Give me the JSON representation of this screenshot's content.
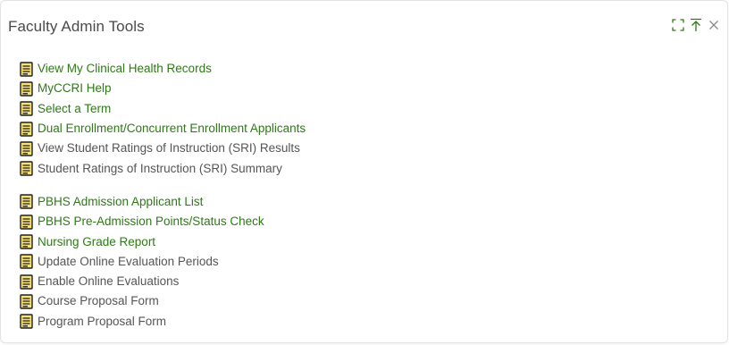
{
  "portlet": {
    "title": "Faculty Admin Tools",
    "controls": [
      {
        "name": "maximize-icon"
      },
      {
        "name": "move-to-top-icon"
      },
      {
        "name": "close-icon"
      }
    ]
  },
  "colors": {
    "link_green": "#2d7a16",
    "text_gray": "#555555",
    "icon_fill": "#f7e27a",
    "icon_stroke": "#1e1e1e"
  },
  "groups": [
    {
      "items": [
        {
          "label": "View My Clinical Health Records",
          "style": "green"
        },
        {
          "label": "MyCCRI Help",
          "style": "green"
        },
        {
          "label": "Select a Term",
          "style": "green"
        },
        {
          "label": "Dual Enrollment/Concurrent Enrollment Applicants",
          "style": "green"
        },
        {
          "label": "View Student Ratings of Instruction (SRI) Results",
          "style": "gray"
        },
        {
          "label": "Student Ratings of Instruction (SRI) Summary",
          "style": "gray"
        }
      ]
    },
    {
      "items": [
        {
          "label": "PBHS Admission Applicant List",
          "style": "green"
        },
        {
          "label": "PBHS Pre-Admission Points/Status Check",
          "style": "green"
        },
        {
          "label": "Nursing Grade Report",
          "style": "green"
        },
        {
          "label": "Update Online Evaluation Periods",
          "style": "gray"
        },
        {
          "label": "Enable Online Evaluations",
          "style": "gray"
        },
        {
          "label": "Course Proposal Form",
          "style": "gray"
        },
        {
          "label": "Program Proposal Form",
          "style": "gray"
        }
      ]
    }
  ]
}
